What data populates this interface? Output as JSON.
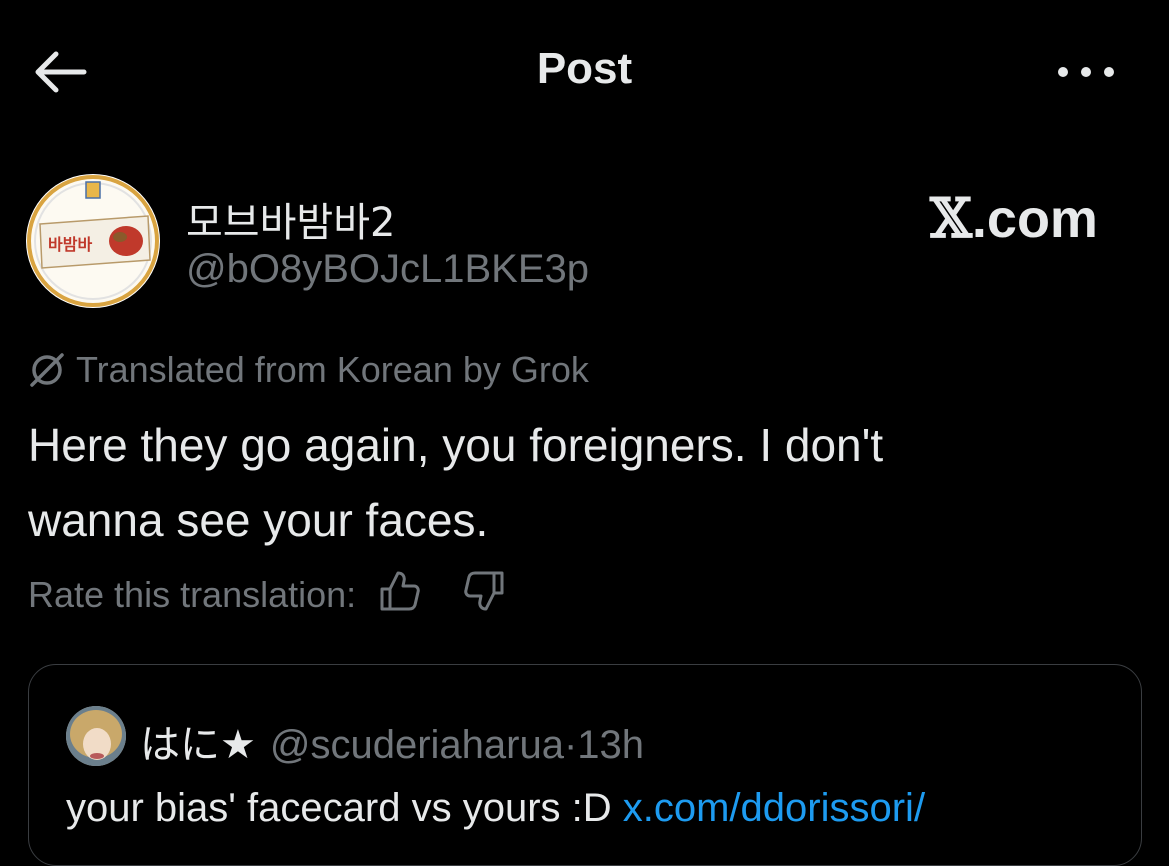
{
  "header": {
    "title": "Post"
  },
  "post": {
    "display_name": "모브바밤바2",
    "handle": "@bO8yBOJcL1BKE3p",
    "watermark": "𝕏.com",
    "watermark_x": "𝕏",
    "watermark_rest": ".com",
    "avatar_product_text": "바밤바",
    "translation_label": "Translated from Korean by Grok",
    "text_line1": "Here they go again, you foreigners. I don't",
    "text_line2": "wanna see your faces.",
    "rate_label": "Rate this translation:"
  },
  "quote": {
    "display_name": "はに★",
    "handle": "@scuderiaharua",
    "separator": "·",
    "time": "13h",
    "text": "your bias' facecard vs yours :D",
    "link": "x.com/ddorissori/"
  },
  "colors": {
    "background": "#000000",
    "text": "#e7e9ea",
    "muted": "#71767b",
    "link": "#1d9bf0",
    "border": "#3a3d41"
  },
  "icons": [
    "back-arrow-icon",
    "more-dots-icon",
    "grok-translate-icon",
    "thumbs-up-icon",
    "thumbs-down-icon"
  ]
}
